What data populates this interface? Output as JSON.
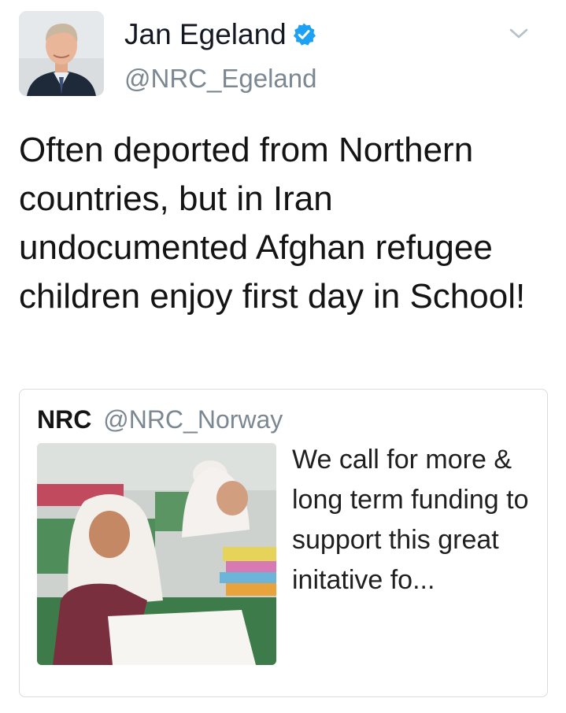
{
  "tweet": {
    "author_name": "Jan Egeland",
    "author_handle": "@NRC_Egeland",
    "verified_icon": "verified-badge-icon",
    "menu_icon": "chevron-down-icon",
    "text": "Often deported from Northern countries, but in Iran undocumented Afghan refugee children enjoy first day in School!"
  },
  "quoted_tweet": {
    "author_name": "NRC",
    "author_handle": "@NRC_Norway",
    "text": "We call for more & long term funding to support this great initative fo..."
  },
  "colors": {
    "verified_blue": "#1da1f2",
    "secondary_text": "#7b8791",
    "card_border": "#d7dce0"
  }
}
